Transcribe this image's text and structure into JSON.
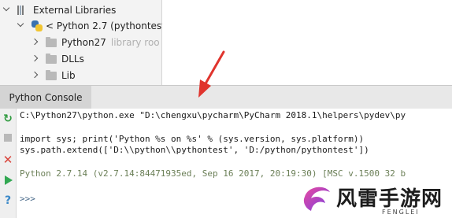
{
  "project_tree": {
    "external_libraries": "External Libraries",
    "sdk": {
      "label": "< Python 2.7 (pythontest"
    },
    "items": [
      {
        "label": "Python27",
        "suffix": "library roo"
      },
      {
        "label": "DLLs",
        "suffix": ""
      },
      {
        "label": "Lib",
        "suffix": ""
      }
    ]
  },
  "console": {
    "tab_label": "Python Console",
    "lines": [
      "C:\\Python27\\python.exe \"D:\\chengxu\\pycharm\\PyCharm 2018.1\\helpers\\pydev\\py",
      "",
      "import sys; print('Python %s on %s' % (sys.version, sys.platform))",
      "sys.path.extend(['D:\\\\python\\\\pythontest', 'D:/python/pythontest'])",
      "",
      "Python 2.7.14 (v2.7.14:84471935ed, Sep 16 2017, 20:19:30) [MSC v.1500 32 b",
      "",
      ">>>"
    ]
  },
  "toolbar": {
    "icons": [
      "rerun-icon",
      "stop-icon",
      "close-icon",
      "run-icon",
      "help-icon"
    ],
    "rerun_glyph": "↻",
    "close_glyph": "✕",
    "help_glyph": "?"
  },
  "watermark": {
    "text": "风雷手游网",
    "sub": "FENGLEI"
  },
  "colors": {
    "arrow": "#e0342d",
    "rerun": "#2e9a3e",
    "run": "#32a852",
    "close": "#d9443b",
    "help": "#3a88c8",
    "version_text": "#6b7f57"
  }
}
